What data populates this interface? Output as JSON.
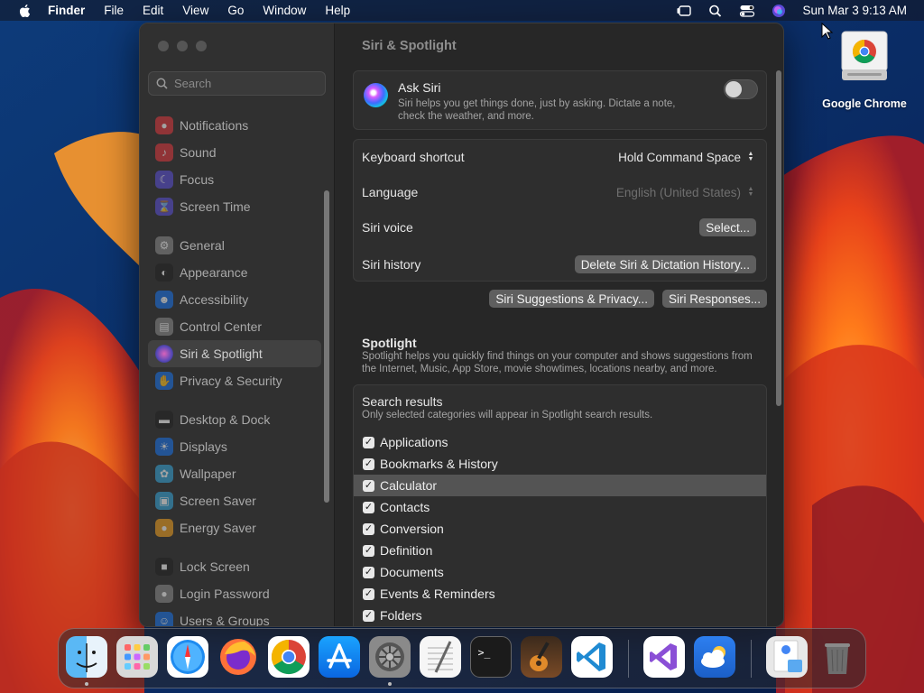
{
  "menubar": {
    "app_name": "Finder",
    "items": [
      "File",
      "Edit",
      "View",
      "Go",
      "Window",
      "Help"
    ],
    "clock": "Sun Mar 3  9:13 AM"
  },
  "desktop": {
    "icons": [
      {
        "label": "Google Chrome",
        "icon": "chrome-drive-icon"
      }
    ]
  },
  "window": {
    "title": "Siri & Spotlight",
    "search": {
      "placeholder": "Search",
      "value": ""
    },
    "sidebar": {
      "items": [
        {
          "label": "Notifications",
          "icon": "bell-icon",
          "color": "#e0383e"
        },
        {
          "label": "Sound",
          "icon": "speaker-icon",
          "color": "#e0383e"
        },
        {
          "label": "Focus",
          "icon": "moon-icon",
          "color": "#5b4fd6"
        },
        {
          "label": "Screen Time",
          "icon": "hourglass-icon",
          "color": "#5b4fd6"
        },
        {
          "label": "General",
          "icon": "gear-icon",
          "color": "#8a8a8a"
        },
        {
          "label": "Appearance",
          "icon": "appearance-icon",
          "color": "#222222"
        },
        {
          "label": "Accessibility",
          "icon": "accessibility-icon",
          "color": "#1a73e8"
        },
        {
          "label": "Control Center",
          "icon": "control-center-icon",
          "color": "#8a8a8a"
        },
        {
          "label": "Siri & Spotlight",
          "icon": "siri-icon",
          "color": "#b04fd6"
        },
        {
          "label": "Privacy & Security",
          "icon": "hand-icon",
          "color": "#1a73e8"
        },
        {
          "label": "Desktop & Dock",
          "icon": "dock-icon",
          "color": "#222222"
        },
        {
          "label": "Displays",
          "icon": "sun-icon",
          "color": "#1a73e8"
        },
        {
          "label": "Wallpaper",
          "icon": "wallpaper-icon",
          "color": "#36a6d8"
        },
        {
          "label": "Screen Saver",
          "icon": "screen-saver-icon",
          "color": "#36a6d8"
        },
        {
          "label": "Energy Saver",
          "icon": "bulb-icon",
          "color": "#f0a020"
        },
        {
          "label": "Lock Screen",
          "icon": "lock-icon",
          "color": "#222222"
        },
        {
          "label": "Login Password",
          "icon": "key-icon",
          "color": "#8a8a8a"
        },
        {
          "label": "Users & Groups",
          "icon": "users-icon",
          "color": "#1a73e8"
        }
      ],
      "active": "Siri & Spotlight"
    },
    "ask_siri": {
      "title": "Ask Siri",
      "description": "Siri helps you get things done, just by asking. Dictate a note, check the weather, and more.",
      "enabled": false
    },
    "settings": {
      "keyboard_shortcut": {
        "label": "Keyboard shortcut",
        "value": "Hold Command Space"
      },
      "language": {
        "label": "Language",
        "value": "English (United States)"
      },
      "siri_voice": {
        "label": "Siri voice",
        "button": "Select..."
      },
      "siri_history": {
        "label": "Siri history",
        "button": "Delete Siri & Dictation History..."
      }
    },
    "buttons": {
      "suggestions_privacy": "Siri Suggestions & Privacy...",
      "responses": "Siri Responses..."
    },
    "spotlight": {
      "title": "Spotlight",
      "description": "Spotlight helps you quickly find things on your computer and shows suggestions from the Internet, Music, App Store, movie showtimes, locations nearby, and more."
    },
    "search_results": {
      "title": "Search results",
      "description": "Only selected categories will appear in Spotlight search results.",
      "categories": [
        {
          "label": "Applications",
          "checked": true
        },
        {
          "label": "Bookmarks & History",
          "checked": true
        },
        {
          "label": "Calculator",
          "checked": true
        },
        {
          "label": "Contacts",
          "checked": true
        },
        {
          "label": "Conversion",
          "checked": true
        },
        {
          "label": "Definition",
          "checked": true
        },
        {
          "label": "Documents",
          "checked": true
        },
        {
          "label": "Events & Reminders",
          "checked": true
        },
        {
          "label": "Folders",
          "checked": true
        }
      ],
      "highlighted": "Calculator"
    }
  },
  "dock": {
    "apps": [
      {
        "name": "finder-icon",
        "running": true
      },
      {
        "name": "launchpad-icon",
        "running": false
      },
      {
        "name": "safari-icon",
        "running": false
      },
      {
        "name": "firefox-icon",
        "running": false
      },
      {
        "name": "chrome-icon",
        "running": false
      },
      {
        "name": "app-store-icon",
        "running": false
      },
      {
        "name": "system-settings-icon",
        "running": true
      },
      {
        "name": "textedit-icon",
        "running": false
      },
      {
        "name": "terminal-icon",
        "running": false
      },
      {
        "name": "garageband-icon",
        "running": false
      },
      {
        "name": "vscode-icon",
        "running": false
      },
      {
        "name": "visual-studio-icon",
        "running": false
      },
      {
        "name": "cloud-app-icon",
        "running": false
      },
      {
        "name": "downloads-stack-icon",
        "running": false
      },
      {
        "name": "trash-icon",
        "running": false
      }
    ]
  }
}
